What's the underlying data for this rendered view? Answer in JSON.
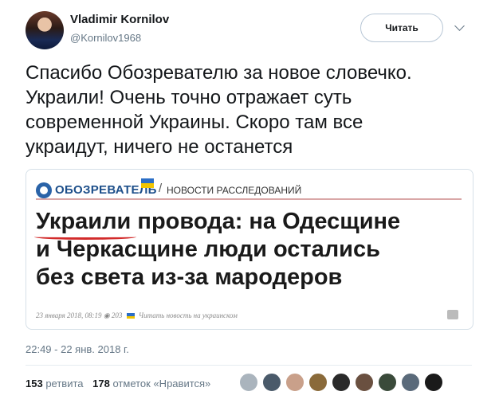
{
  "user": {
    "name": "Vladimir Kornilov",
    "handle": "@Kornilov1968"
  },
  "follow_label": "Читать",
  "tweet_lines": [
    "Спасибо Обозревателю за новое словечко.",
    "Украили! Очень точно отражает суть",
    "современной Украины. Скоро там все",
    "украидут, ничего не останется"
  ],
  "card": {
    "logo": "ОБОЗРЕВАТЕЛЬ",
    "slash": "/",
    "section": "НОВОСТИ РАССЛЕДОВАНИЙ",
    "headline_word": "Украили",
    "headline_rest": " провода: на Одесщине",
    "headline_line2": "и Черкасщине люди остались",
    "headline_line3": "без света из-за мародеров",
    "meta_date": "23 января 2018, 08:19",
    "meta_views": "203",
    "meta_link": "Читать новость на украинском"
  },
  "timestamp": "22:49 - 22 янв. 2018 г.",
  "stats": {
    "retweets_count": "153",
    "retweets_label": "ретвита",
    "likes_count": "178",
    "likes_label": "отметок «Нравится»"
  },
  "colors": {
    "accent": "#1da1f2",
    "muted": "#657786",
    "underline_red": "#d22b2b"
  },
  "icons": [
    "chevron-down-icon",
    "logo-circle-icon",
    "ukraine-flag-icon",
    "views-icon",
    "print-icon"
  ]
}
